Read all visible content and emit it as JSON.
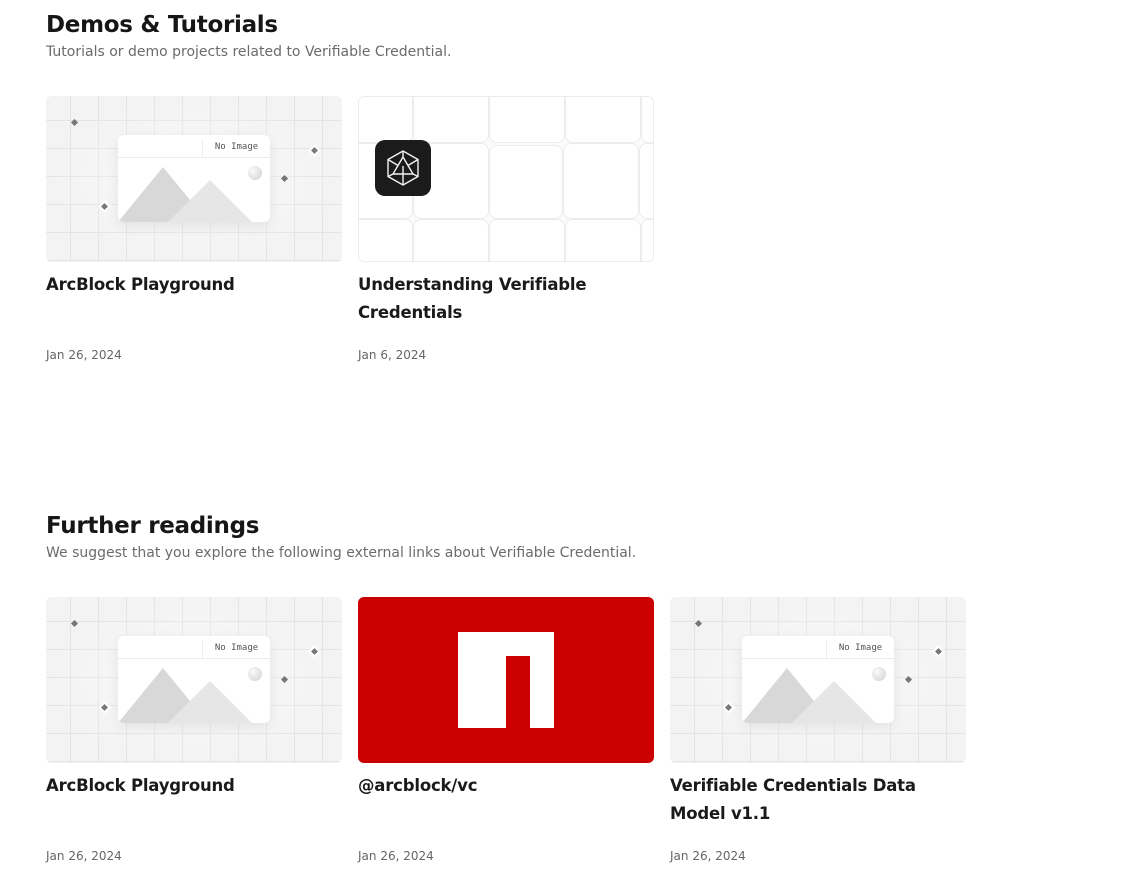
{
  "demos": {
    "title": "Demos & Tutorials",
    "subtitle": "Tutorials or demo projects related to Verifiable Credential.",
    "cards": [
      {
        "title": "ArcBlock Playground",
        "date": "Jan 26, 2024",
        "thumb": "no-image",
        "thumb_label": "No Image"
      },
      {
        "title": "Understanding Verifiable Credentials",
        "date": "Jan 6, 2024",
        "thumb": "arcblock-logo"
      }
    ]
  },
  "further": {
    "title": "Further readings",
    "subtitle": "We suggest that you explore the following external links about Verifiable Credential.",
    "cards": [
      {
        "title": "ArcBlock Playground",
        "date": "Jan 26, 2024",
        "thumb": "no-image",
        "thumb_label": "No Image"
      },
      {
        "title": "@arcblock/vc",
        "date": "Jan 26, 2024",
        "thumb": "npm-logo"
      },
      {
        "title": "Verifiable Credentials Data Model v1.1",
        "date": "Jan 26, 2024",
        "thumb": "no-image",
        "thumb_label": "No Image"
      }
    ]
  },
  "colors": {
    "npm_red": "#cb0000",
    "text": "#1a1a1a",
    "muted": "#6b6b6b"
  }
}
